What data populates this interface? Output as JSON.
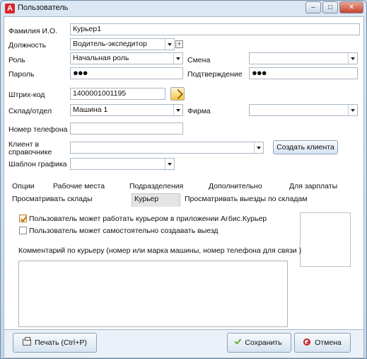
{
  "window": {
    "title": "Пользователь",
    "app_icon": "A",
    "accent": "#d9252b"
  },
  "form": {
    "fio_label": "Фамилия И.О.",
    "fio_value": "Курьер1",
    "position_label": "Должность",
    "position_value": "Водитель-экспедитор",
    "role_label": "Роль",
    "role_value": "Начальная роль",
    "shift_label": "Смена",
    "shift_value": "",
    "password_label": "Пароль",
    "password_value": "●●●",
    "confirm_label": "Подтверждение",
    "confirm_value": "●●●",
    "barcode_label": "Штрих-код",
    "barcode_value": "1400001001195",
    "warehouse_label": "Склад/отдел",
    "warehouse_value": "Машина 1",
    "company_label": "Фирма",
    "company_value": "",
    "phone_label": "Номер телефона",
    "phone_value": "",
    "client_label_1": "Клиент в",
    "client_label_2": "справочнике",
    "client_value": "",
    "create_client_button": "Создать клиента",
    "schedule_label": "Шаблон графика",
    "schedule_value": ""
  },
  "tabs": {
    "row1": [
      "Опции",
      "Рабочие места",
      "Подразделения",
      "Дополнительно",
      "Для зарплаты"
    ],
    "row2": [
      "Просматривать склады",
      "Курьер",
      "Просматривать выезды по складам"
    ],
    "active": "Курьер"
  },
  "courier": {
    "check1_label": "Пользователь может работать курьером в приложении Агбис.Курьер",
    "check1_checked": true,
    "check2_label": "Пользователь может самостоятельно создавать выезд",
    "check2_checked": false,
    "comment_label": "Комментарий по курьеру (номер или марка машины, номер телефона для связи )",
    "comment_value": ""
  },
  "footer": {
    "print_button": "Печать (Ctrl+P)",
    "save_button": "Сохранить",
    "cancel_button": "Отмена"
  }
}
